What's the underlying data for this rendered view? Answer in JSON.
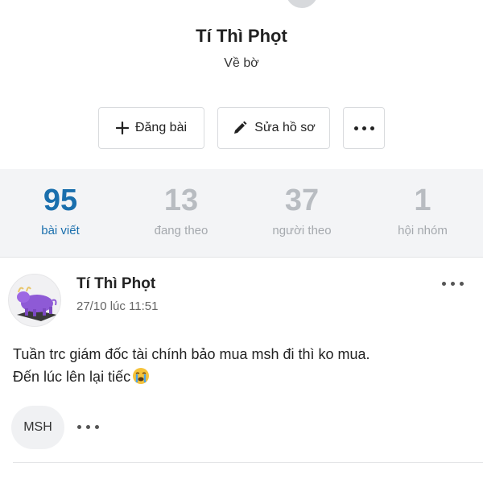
{
  "profile": {
    "name": "Tí Thì Phọt",
    "bio": "Về bờ"
  },
  "actions": {
    "post_label": "Đăng bài",
    "edit_label": "Sửa hồ sơ",
    "more_icon": "more-dots-icon",
    "post_icon": "plus-icon",
    "edit_icon": "pencil-icon"
  },
  "stats": [
    {
      "value": "95",
      "label": "bài viết"
    },
    {
      "value": "13",
      "label": "đang theo"
    },
    {
      "value": "37",
      "label": "người theo"
    },
    {
      "value": "1",
      "label": "hội nhóm"
    }
  ],
  "colors": {
    "accent": "#1a6fad",
    "muted": "#b8bcc1",
    "stats_bg": "#f3f4f6"
  },
  "post": {
    "author": "Tí Thì Phọt",
    "time": "27/10 lúc 11:51",
    "line1": "Tuần trc giám đốc tài chính bảo mua msh đi thì ko mua.",
    "line2": "Đến lúc lên lại tiếc",
    "tag": "MSH"
  }
}
